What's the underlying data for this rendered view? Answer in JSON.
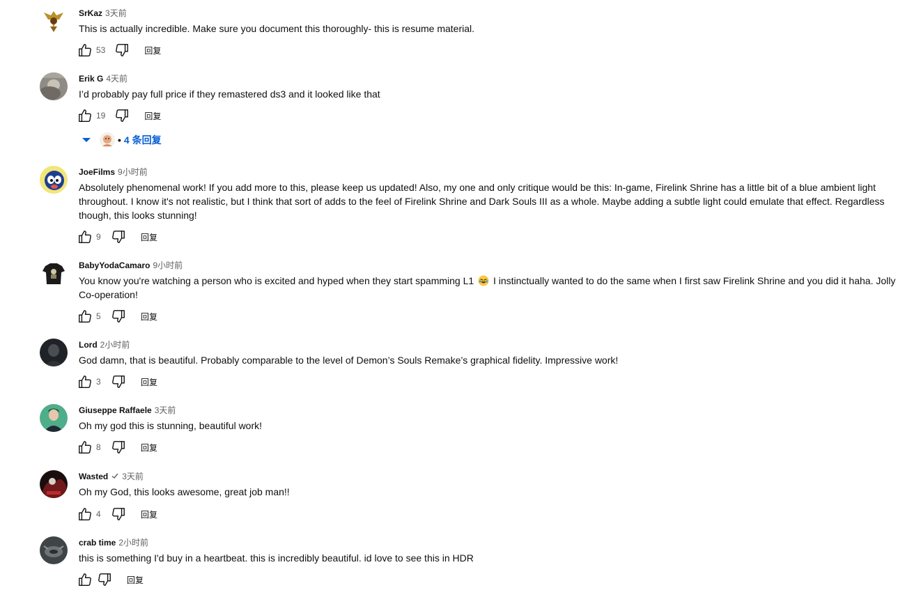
{
  "reply_label": "回复",
  "comments": [
    {
      "author": "SrKaz",
      "time": "3天前",
      "text": "This is actually incredible. Make sure you document this thoroughly- this is resume material.",
      "likes": "53",
      "avatar": "golden-eagle-crest-avatar"
    },
    {
      "author": "Erik G",
      "time": "4天前",
      "text": "I’d probably pay full price if they remastered ds3 and it looked like that",
      "likes": "19",
      "avatar": "gray-photo-avatar"
    },
    {
      "author": "JoeFilms",
      "time": "9小时前",
      "text": "Absolutely phenomenal work! If you add more to this, please keep us updated! Also, my one and only critique would be this: In-game, Firelink Shrine has a little bit of a blue ambient light throughout. I know it's not realistic, but I think that sort of adds to the feel of Firelink Shrine and Dark Souls III as a whole. Maybe adding a subtle light could emulate that effect. Regardless though, this looks stunning!",
      "likes": "9",
      "avatar": "cartoon-character-avatar"
    },
    {
      "author": "BabyYodaCamaro",
      "time": "9小时前",
      "text_before": "You know you're watching a person who is excited and hyped when they start spamming L1",
      "text_after": "I instinctually wanted to do the same when I first saw Firelink Shrine and you did it haha. Jolly Co-operation!",
      "emoji": "rolling-laughing-emoji",
      "likes": "5",
      "avatar": "black-tshirt-avatar"
    },
    {
      "author": "Lord",
      "time": "2小时前",
      "text": "God damn, that is beautiful. Probably comparable to the level of Demon’s Souls Remake’s graphical fidelity. Impressive work!",
      "likes": "3",
      "avatar": "dark-portrait-avatar"
    },
    {
      "author": "Giuseppe Raffaele",
      "time": "3天前",
      "text": "Oh my god this is stunning, beautiful work!",
      "likes": "8",
      "avatar": "green-portrait-avatar"
    },
    {
      "author": "Wasted",
      "time": "3天前",
      "verified": true,
      "text": "Oh my God, this looks awesome, great job man!!",
      "likes": "4",
      "avatar": "red-dark-art-avatar"
    },
    {
      "author": "crab time",
      "time": "2小时前",
      "text": "this is something I'd buy in a heartbeat. this is incredibly beautiful. id love to see this in HDR",
      "likes": "",
      "avatar": "crab-photo-avatar"
    }
  ],
  "replies_toggle": {
    "label": "4 条回复",
    "separator": "•",
    "icon": "chevron-down-icon",
    "color": "#065fd4"
  },
  "colors": {
    "text": "#0f0f0f",
    "secondary": "#606060",
    "link": "#065fd4"
  }
}
